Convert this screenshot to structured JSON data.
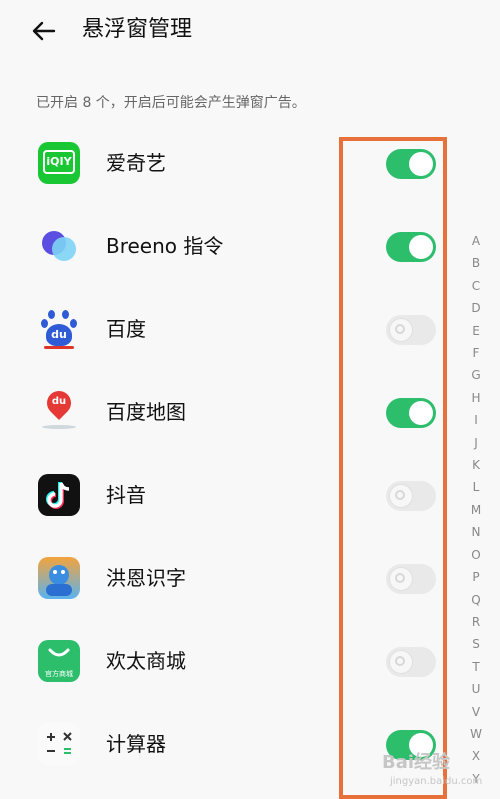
{
  "header": {
    "title": "悬浮窗管理"
  },
  "subtitle": "已开启 8 个，开启后可能会产生弹窗广告。",
  "apps": [
    {
      "name": "爱奇艺",
      "enabled": true,
      "icon": "iqiyi-icon"
    },
    {
      "name": "Breeno 指令",
      "enabled": true,
      "icon": "breeno-icon"
    },
    {
      "name": "百度",
      "enabled": false,
      "icon": "baidu-icon"
    },
    {
      "name": "百度地图",
      "enabled": true,
      "icon": "baidu-map-icon"
    },
    {
      "name": "抖音",
      "enabled": false,
      "icon": "douyin-icon"
    },
    {
      "name": "洪恩识字",
      "enabled": false,
      "icon": "hongen-icon"
    },
    {
      "name": "欢太商城",
      "enabled": false,
      "icon": "heytap-store-icon"
    },
    {
      "name": "计算器",
      "enabled": true,
      "icon": "calculator-icon"
    }
  ],
  "app_icon_texts": {
    "iqiyi": "iQIY",
    "baidu_du": "du",
    "baidu_map_du": "du",
    "store_label": "官方商城"
  },
  "alphabet_index": [
    "A",
    "B",
    "C",
    "D",
    "E",
    "F",
    "G",
    "H",
    "I",
    "J",
    "K",
    "L",
    "M",
    "N",
    "O",
    "P",
    "Q",
    "R",
    "S",
    "T",
    "U",
    "V",
    "W",
    "X",
    "Y"
  ],
  "watermark": {
    "main": "Bai经验",
    "sub": "jingyan.baidu.com"
  },
  "colors": {
    "toggle_on": "#2dbe6c",
    "toggle_off": "#e9e9e9",
    "highlight": "#e8703a"
  }
}
